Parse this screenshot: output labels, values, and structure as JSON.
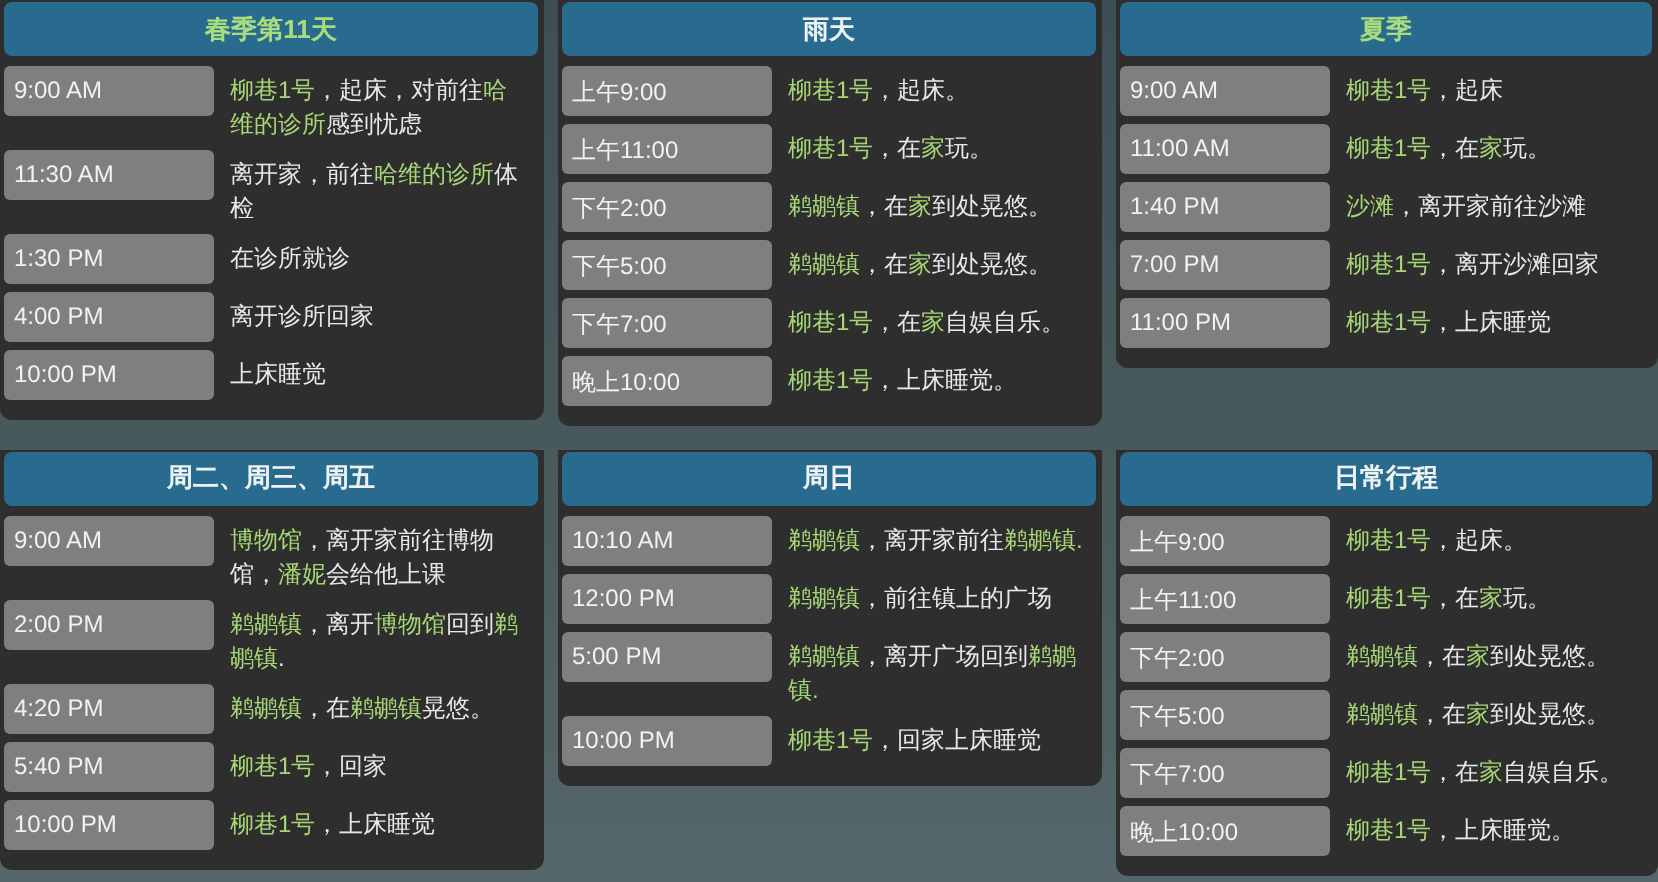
{
  "cards": [
    {
      "title": "春季第11天",
      "accent": true,
      "rows": [
        {
          "time": "9:00 AM",
          "text": [
            {
              "t": "柳巷1号",
              "kind": "place"
            },
            {
              "t": "，起床，对前往",
              "kind": "plain"
            },
            {
              "t": "哈维的诊所",
              "kind": "place"
            },
            {
              "t": "感到忧虑",
              "kind": "plain"
            }
          ]
        },
        {
          "time": "11:30 AM",
          "text": [
            {
              "t": "离开家，前往",
              "kind": "plain"
            },
            {
              "t": "哈维的诊所",
              "kind": "place"
            },
            {
              "t": "体检",
              "kind": "plain"
            }
          ]
        },
        {
          "time": "1:30 PM",
          "text": [
            {
              "t": "在诊所就诊",
              "kind": "plain"
            }
          ]
        },
        {
          "time": "4:00 PM",
          "text": [
            {
              "t": "离开诊所回家",
              "kind": "plain"
            }
          ]
        },
        {
          "time": "10:00 PM",
          "text": [
            {
              "t": "上床睡觉",
              "kind": "plain"
            }
          ]
        }
      ]
    },
    {
      "title": "雨天",
      "accent": false,
      "rows": [
        {
          "time": "上午9:00",
          "text": [
            {
              "t": "柳巷1号",
              "kind": "place"
            },
            {
              "t": "，起床。",
              "kind": "plain"
            }
          ]
        },
        {
          "time": "上午11:00",
          "text": [
            {
              "t": "柳巷1号",
              "kind": "place"
            },
            {
              "t": "，在",
              "kind": "plain"
            },
            {
              "t": "家",
              "kind": "place"
            },
            {
              "t": "玩。",
              "kind": "plain"
            }
          ]
        },
        {
          "time": "下午2:00",
          "text": [
            {
              "t": "鹈鹕镇",
              "kind": "place"
            },
            {
              "t": "，在",
              "kind": "plain"
            },
            {
              "t": "家",
              "kind": "place"
            },
            {
              "t": "到处晃悠。",
              "kind": "plain"
            }
          ]
        },
        {
          "time": "下午5:00",
          "text": [
            {
              "t": "鹈鹕镇",
              "kind": "place"
            },
            {
              "t": "，在",
              "kind": "plain"
            },
            {
              "t": "家",
              "kind": "place"
            },
            {
              "t": "到处晃悠。",
              "kind": "plain"
            }
          ]
        },
        {
          "time": "下午7:00",
          "text": [
            {
              "t": "柳巷1号",
              "kind": "place"
            },
            {
              "t": "，在",
              "kind": "plain"
            },
            {
              "t": "家",
              "kind": "place"
            },
            {
              "t": "自娱自乐。",
              "kind": "plain"
            }
          ]
        },
        {
          "time": "晚上10:00",
          "text": [
            {
              "t": "柳巷1号",
              "kind": "place"
            },
            {
              "t": "，上床睡觉。",
              "kind": "plain"
            }
          ]
        }
      ]
    },
    {
      "title": "夏季",
      "accent": true,
      "rows": [
        {
          "time": "9:00 AM",
          "text": [
            {
              "t": "柳巷1号",
              "kind": "place"
            },
            {
              "t": "，起床",
              "kind": "plain"
            }
          ]
        },
        {
          "time": "11:00 AM",
          "text": [
            {
              "t": "柳巷1号",
              "kind": "place"
            },
            {
              "t": "，在",
              "kind": "plain"
            },
            {
              "t": "家",
              "kind": "place"
            },
            {
              "t": "玩。",
              "kind": "plain"
            }
          ]
        },
        {
          "time": "1:40 PM",
          "text": [
            {
              "t": "沙滩",
              "kind": "place"
            },
            {
              "t": "，离开家前往沙滩",
              "kind": "plain"
            }
          ]
        },
        {
          "time": "7:00 PM",
          "text": [
            {
              "t": "柳巷1号",
              "kind": "place"
            },
            {
              "t": "，离开沙滩回家",
              "kind": "plain"
            }
          ]
        },
        {
          "time": "11:00 PM",
          "text": [
            {
              "t": "柳巷1号",
              "kind": "place"
            },
            {
              "t": "，上床睡觉",
              "kind": "plain"
            }
          ]
        }
      ]
    },
    {
      "title": "周二、周三、周五",
      "accent": false,
      "rows": [
        {
          "time": "9:00 AM",
          "text": [
            {
              "t": "博物馆",
              "kind": "place"
            },
            {
              "t": "，离开家前往博物馆，",
              "kind": "plain"
            },
            {
              "t": "潘妮",
              "kind": "place"
            },
            {
              "t": "会给他上课",
              "kind": "plain"
            }
          ]
        },
        {
          "time": "2:00 PM",
          "text": [
            {
              "t": "鹈鹕镇",
              "kind": "place"
            },
            {
              "t": "，离开",
              "kind": "plain"
            },
            {
              "t": "博物馆",
              "kind": "place"
            },
            {
              "t": "回到",
              "kind": "plain"
            },
            {
              "t": "鹈鹕镇",
              "kind": "place"
            },
            {
              "t": ".",
              "kind": "plain"
            }
          ]
        },
        {
          "time": "4:20 PM",
          "text": [
            {
              "t": "鹈鹕镇",
              "kind": "place"
            },
            {
              "t": "，在",
              "kind": "plain"
            },
            {
              "t": "鹈鹕镇",
              "kind": "place"
            },
            {
              "t": "晃悠。",
              "kind": "plain"
            }
          ]
        },
        {
          "time": "5:40 PM",
          "text": [
            {
              "t": "柳巷1号",
              "kind": "place"
            },
            {
              "t": "，回家",
              "kind": "plain"
            }
          ]
        },
        {
          "time": "10:00 PM",
          "text": [
            {
              "t": "柳巷1号",
              "kind": "place"
            },
            {
              "t": "，上床睡觉",
              "kind": "plain"
            }
          ]
        }
      ]
    },
    {
      "title": "周日",
      "accent": false,
      "rows": [
        {
          "time": "10:10 AM",
          "text": [
            {
              "t": "鹈鹕镇",
              "kind": "place"
            },
            {
              "t": "，离开家前往",
              "kind": "plain"
            },
            {
              "t": "鹈鹕镇.",
              "kind": "place"
            }
          ]
        },
        {
          "time": "12:00 PM",
          "text": [
            {
              "t": "鹈鹕镇",
              "kind": "place"
            },
            {
              "t": "，前往镇上的广场",
              "kind": "plain"
            }
          ]
        },
        {
          "time": "5:00 PM",
          "text": [
            {
              "t": "鹈鹕镇",
              "kind": "place"
            },
            {
              "t": "，离开广场回到",
              "kind": "plain"
            },
            {
              "t": "鹈鹕镇.",
              "kind": "place"
            }
          ]
        },
        {
          "time": "10:00 PM",
          "text": [
            {
              "t": "柳巷1号",
              "kind": "place"
            },
            {
              "t": "，回家上床睡觉",
              "kind": "plain"
            }
          ]
        }
      ]
    },
    {
      "title": "日常行程",
      "accent": false,
      "rows": [
        {
          "time": "上午9:00",
          "text": [
            {
              "t": "柳巷1号",
              "kind": "place"
            },
            {
              "t": "，起床。",
              "kind": "plain"
            }
          ]
        },
        {
          "time": "上午11:00",
          "text": [
            {
              "t": "柳巷1号",
              "kind": "place"
            },
            {
              "t": "，在",
              "kind": "plain"
            },
            {
              "t": "家",
              "kind": "place"
            },
            {
              "t": "玩。",
              "kind": "plain"
            }
          ]
        },
        {
          "time": "下午2:00",
          "text": [
            {
              "t": "鹈鹕镇",
              "kind": "place"
            },
            {
              "t": "，在",
              "kind": "plain"
            },
            {
              "t": "家",
              "kind": "place"
            },
            {
              "t": "到处晃悠。",
              "kind": "plain"
            }
          ]
        },
        {
          "time": "下午5:00",
          "text": [
            {
              "t": "鹈鹕镇",
              "kind": "place"
            },
            {
              "t": "，在",
              "kind": "plain"
            },
            {
              "t": "家",
              "kind": "place"
            },
            {
              "t": "到处晃悠。",
              "kind": "plain"
            }
          ]
        },
        {
          "time": "下午7:00",
          "text": [
            {
              "t": "柳巷1号",
              "kind": "place"
            },
            {
              "t": "，在",
              "kind": "plain"
            },
            {
              "t": "家",
              "kind": "place"
            },
            {
              "t": "自娱自乐。",
              "kind": "plain"
            }
          ]
        },
        {
          "time": "晚上10:00",
          "text": [
            {
              "t": "柳巷1号",
              "kind": "place"
            },
            {
              "t": "，上床睡觉。",
              "kind": "plain"
            }
          ]
        }
      ]
    }
  ]
}
